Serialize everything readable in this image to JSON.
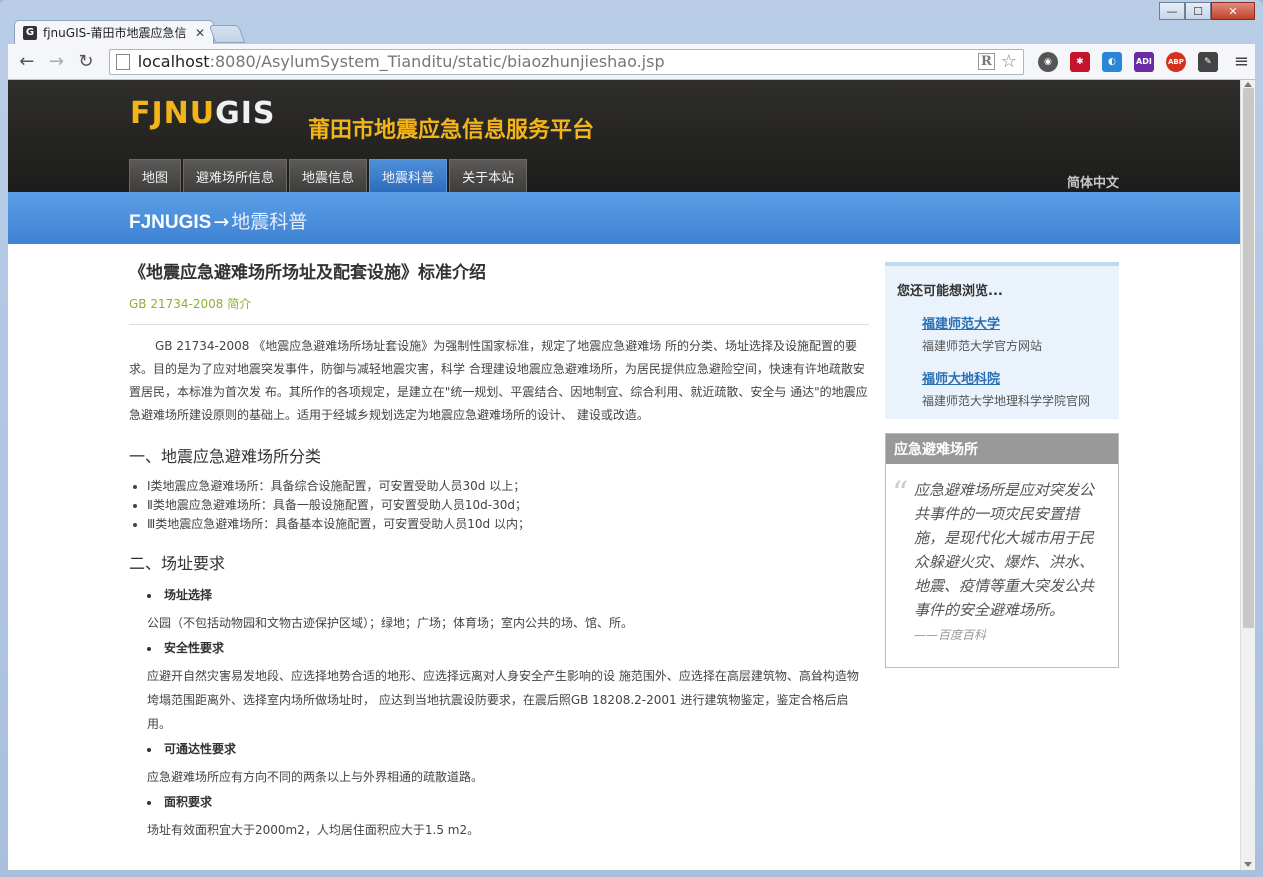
{
  "browser": {
    "tab_title": "fjnuGIS-莆田市地震应急信",
    "tab_close": "✕",
    "favicon_letter": "G",
    "back": "←",
    "forward": "→",
    "reload": "↻",
    "url_host": "localhost",
    "url_path": ":8080/AsylumSystem_Tianditu/static/biaozhunjieshao.jsp",
    "r_icon": "R",
    "star": "☆",
    "menu": "≡",
    "win_min": "—",
    "win_max": "☐",
    "win_close": "✕",
    "extensions": [
      {
        "name": "globe-icon",
        "glyph": "◉"
      },
      {
        "name": "red-ext-icon",
        "glyph": "✱"
      },
      {
        "name": "blue-ext-icon",
        "glyph": "◐"
      },
      {
        "name": "issuu-icon",
        "glyph": "ADI"
      },
      {
        "name": "adblock-icon",
        "glyph": "ABP"
      },
      {
        "name": "evernote-icon",
        "glyph": "✎"
      }
    ]
  },
  "site": {
    "logo_fjnu": "FJNU",
    "logo_gis": "GIS",
    "title": "莆田市地震应急信息服务平台",
    "nav": [
      {
        "label": "地图",
        "active": false
      },
      {
        "label": "避难场所信息",
        "active": false
      },
      {
        "label": "地震信息",
        "active": false
      },
      {
        "label": "地震科普",
        "active": true
      },
      {
        "label": "关于本站",
        "active": false
      }
    ],
    "lang": "简体中文",
    "crumb_brand": "FJNUGIS",
    "crumb_arrow": "→",
    "crumb_section": "地震科普"
  },
  "article": {
    "title": "《地震应急避难场所场址及配套设施》标准介绍",
    "subtitle": "GB 21734-2008 简介",
    "intro": "GB 21734-2008 《地震应急避难场所场址套设施》为强制性国家标准，规定了地震应急避难场 所的分类、场址选择及设施配置的要求。目的是为了应对地震突发事件，防御与减轻地震灾害，科学 合理建设地震应急避难场所，为居民提供应急避险空间，快速有许地疏散安置居民，本标准为首次发 布。其所作的各项规定，是建立在\"统一规划、平震结合、因地制宜、综合利用、就近疏散、安全与 通达\"的地震应急避难场所建设原则的基础上。适用于经城乡规划选定为地震应急避难场所的设计、 建设或改造。",
    "section1": "一、地震应急避难场所分类",
    "categories": [
      "Ⅰ类地震应急避难场所：具备综合设施配置，可安置受助人员30d 以上；",
      "Ⅱ类地震应急避难场所：具备一般设施配置，可安置受助人员10d-30d；",
      "Ⅲ类地震应急避难场所：具备基本设施配置，可安置受助人员10d 以内；"
    ],
    "section2": "二、场址要求",
    "requirements": [
      {
        "label": "场址选择",
        "text": "公园（不包括动物园和文物古迹保护区域）；绿地；广场；体育场；室内公共的场、馆、所。"
      },
      {
        "label": "安全性要求",
        "text": "应避开自然灾害易发地段、应选择地势合适的地形、应选择远离对人身安全产生影响的设 施范围外、应选择在高层建筑物、高耸构造物垮塌范围距离外、选择室内场所做场址时， 应达到当地抗震设防要求，在震后照GB 18208.2-2001 进行建筑物鉴定，鉴定合格后启用。"
      },
      {
        "label": "可通达性要求",
        "text": "应急避难场所应有方向不同的两条以上与外界相通的疏散道路。"
      },
      {
        "label": "面积要求",
        "text": "场址有效面积宜大于2000m2，人均居住面积应大于1.5 m2。"
      }
    ]
  },
  "sidebar": {
    "browse_title": "您还可能想浏览...",
    "links": [
      {
        "name": "福建师范大学",
        "desc": "福建师范大学官方网站"
      },
      {
        "name": "福师大地科院",
        "desc": "福建师范大学地理科学学院官网"
      }
    ],
    "shelter_title": "应急避难场所",
    "quote_mark": "“",
    "quote": "应急避难场所是应对突发公共事件的一项灾民安置措施，是现代化大城市用于民众躲避火灾、爆炸、洪水、地震、疫情等重大突发公共事件的安全避难场所。",
    "quote_source": "——百度百科"
  }
}
